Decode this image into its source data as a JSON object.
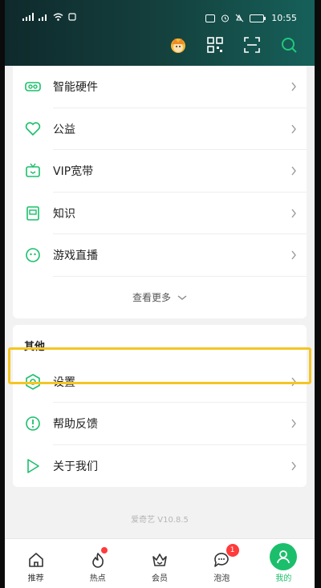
{
  "status_bar": {
    "time": "10:55"
  },
  "toolbar": {
    "icons": [
      "avatar-icon",
      "qr-code-icon",
      "scan-icon",
      "search-icon"
    ]
  },
  "menu": {
    "items": [
      {
        "label": "智能硬件",
        "icon": "vr-headset-icon"
      },
      {
        "label": "公益",
        "icon": "heart-icon"
      },
      {
        "label": "VIP宽带",
        "icon": "tv-icon"
      },
      {
        "label": "知识",
        "icon": "book-icon"
      },
      {
        "label": "游戏直播",
        "icon": "game-icon"
      }
    ],
    "more_label": "查看更多"
  },
  "other_section": {
    "title": "其他",
    "items": [
      {
        "label": "设置",
        "icon": "settings-icon",
        "highlighted": true
      },
      {
        "label": "帮助反馈",
        "icon": "help-icon"
      },
      {
        "label": "关于我们",
        "icon": "play-icon"
      }
    ]
  },
  "version": "爱奇艺 V10.8.5",
  "tabbar": {
    "tabs": [
      {
        "label": "推荐",
        "icon": "home-icon"
      },
      {
        "label": "热点",
        "icon": "flame-icon",
        "dot": true
      },
      {
        "label": "会员",
        "icon": "crown-icon"
      },
      {
        "label": "泡泡",
        "icon": "chat-icon",
        "badge": "1"
      },
      {
        "label": "我的",
        "icon": "user-icon",
        "active": true
      }
    ]
  },
  "colors": {
    "accent": "#1bbf6b",
    "highlight": "#f5c524"
  }
}
